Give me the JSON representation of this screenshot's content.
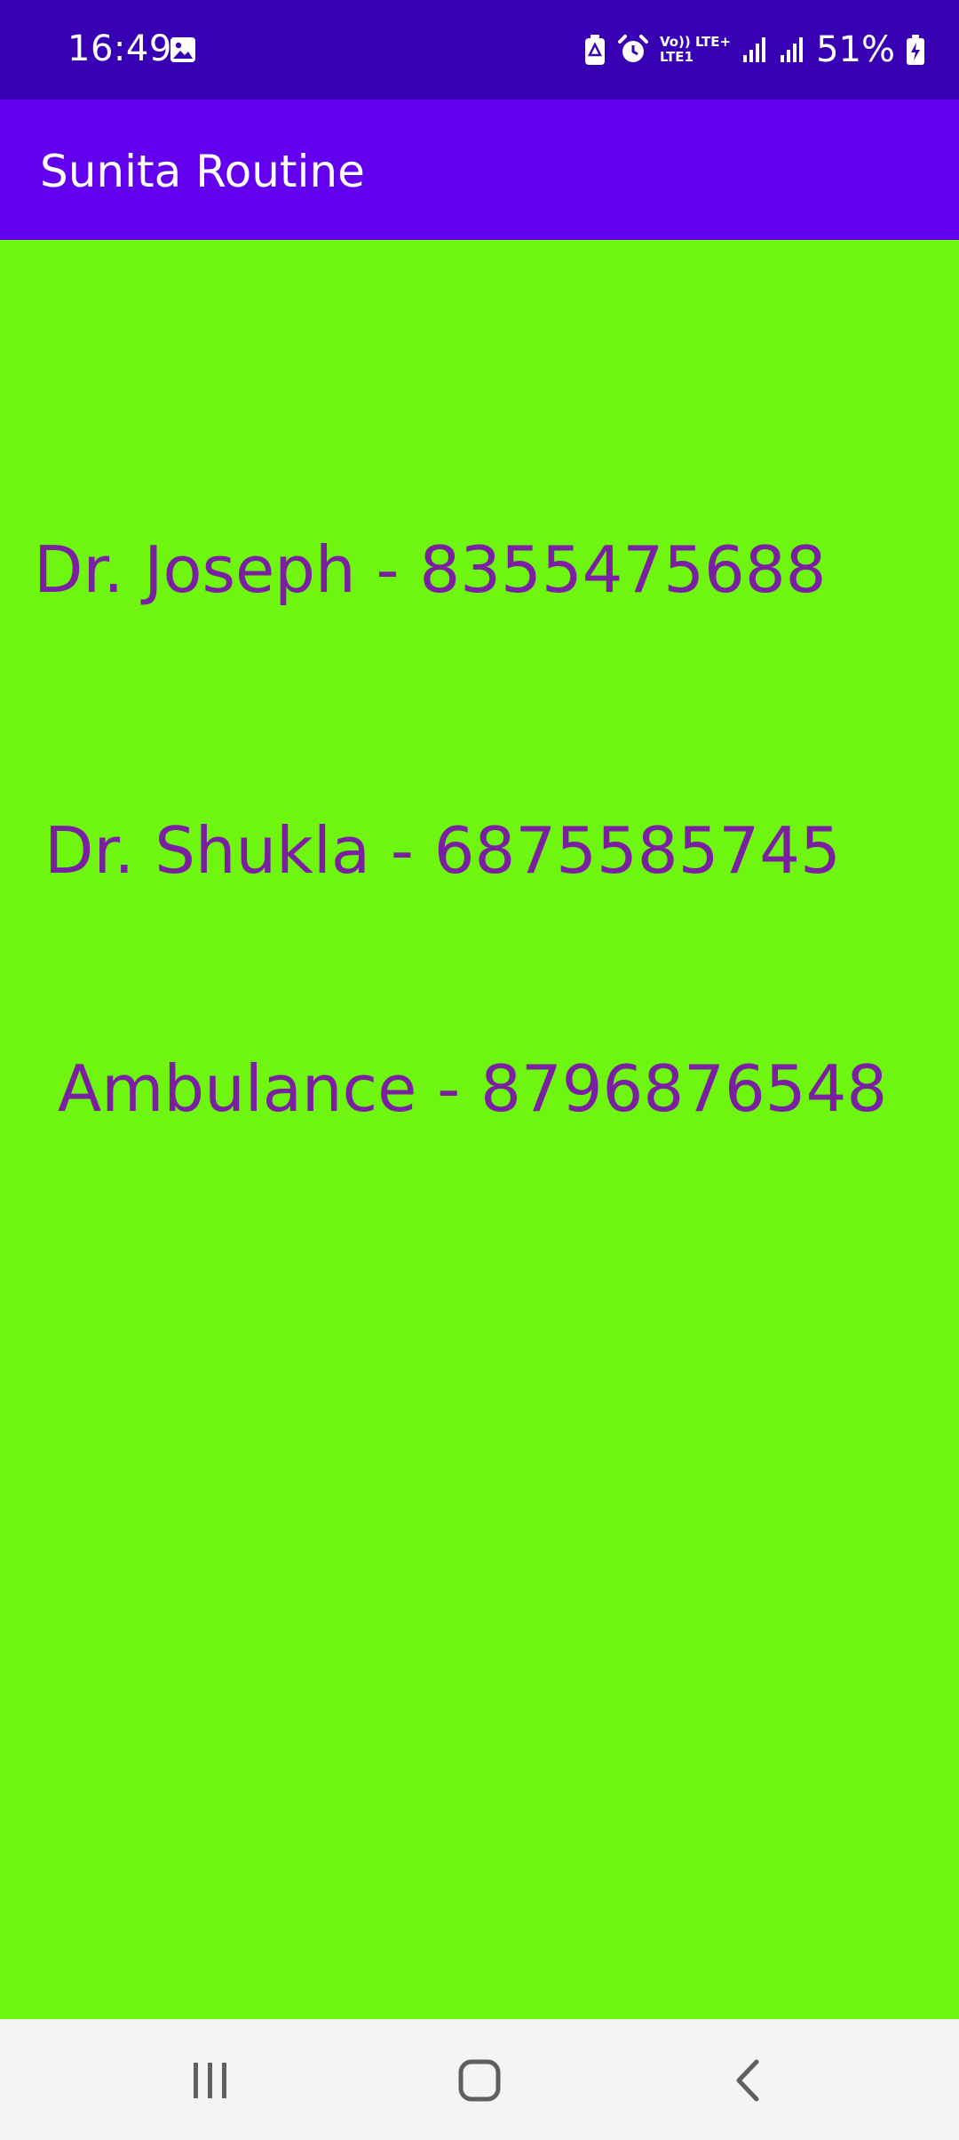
{
  "status_bar": {
    "time": "16:49",
    "network_top": "Vo)) LTE+",
    "network_bottom": "LTE1",
    "battery_percent": "51%",
    "icons": [
      "gallery-icon",
      "battery-saver-icon",
      "alarm-icon",
      "signal-icon",
      "signal-icon",
      "battery-icon"
    ]
  },
  "app_bar": {
    "title": "Sunita Routine"
  },
  "contacts": [
    {
      "label": "Dr. Joseph - 8355475688"
    },
    {
      "label": "Dr. Shukla - 6875585745"
    },
    {
      "label": "Ambulance - 8796876548"
    }
  ],
  "nav_bar": {
    "icons": [
      "recents-icon",
      "home-icon",
      "back-icon"
    ]
  },
  "colors": {
    "status_bar": "#3700b3",
    "app_bar": "#6200ee",
    "background": "#6ef510",
    "contact_text": "#7b1fa2",
    "nav_bar": "#f4f4f4"
  }
}
